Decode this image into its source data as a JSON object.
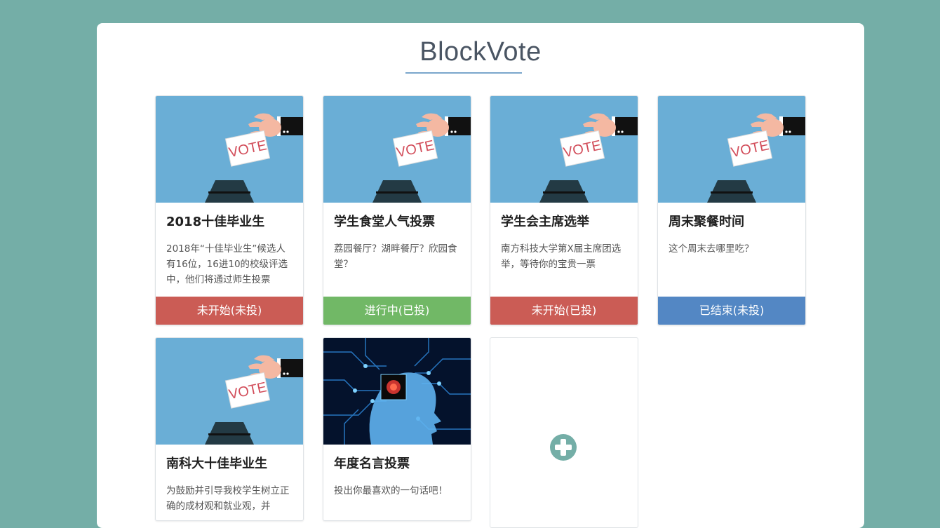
{
  "app": {
    "title": "BlockVote"
  },
  "colors": {
    "background": "#74aea7",
    "status_red": "#cb5c55",
    "status_green": "#71b866",
    "status_blue": "#5387c4",
    "add_icon": "#74aea7"
  },
  "cards": [
    {
      "title": "2018十佳毕业生",
      "description": "2018年“十佳毕业生”候选人有16位，16进10的校级评选中，他们将通过师生投票",
      "status": "未开始(未投)",
      "image": "vote-illustration"
    },
    {
      "title": "学生食堂人气投票",
      "description": "荔园餐厅？湖畔餐厅？欣园食堂？",
      "status": "进行中(已投)",
      "image": "vote-illustration"
    },
    {
      "title": "学生会主席选举",
      "description": "南方科技大学第X届主席团选举，等待你的宝贵一票",
      "status": "未开始(已投)",
      "image": "vote-illustration"
    },
    {
      "title": "周末聚餐时间",
      "description": "这个周末去哪里吃？",
      "status": "已结束(未投)",
      "image": "vote-illustration"
    },
    {
      "title": "南科大十佳毕业生",
      "description": "为鼓励并引导我校学生树立正确的成材观和就业观，并",
      "status": "",
      "image": "vote-illustration"
    },
    {
      "title": "年度名言投票",
      "description": "投出你最喜欢的一句话吧！",
      "status": "",
      "image": "ai-head-illustration"
    }
  ],
  "add_card": {
    "icon": "plus-circle-icon"
  }
}
